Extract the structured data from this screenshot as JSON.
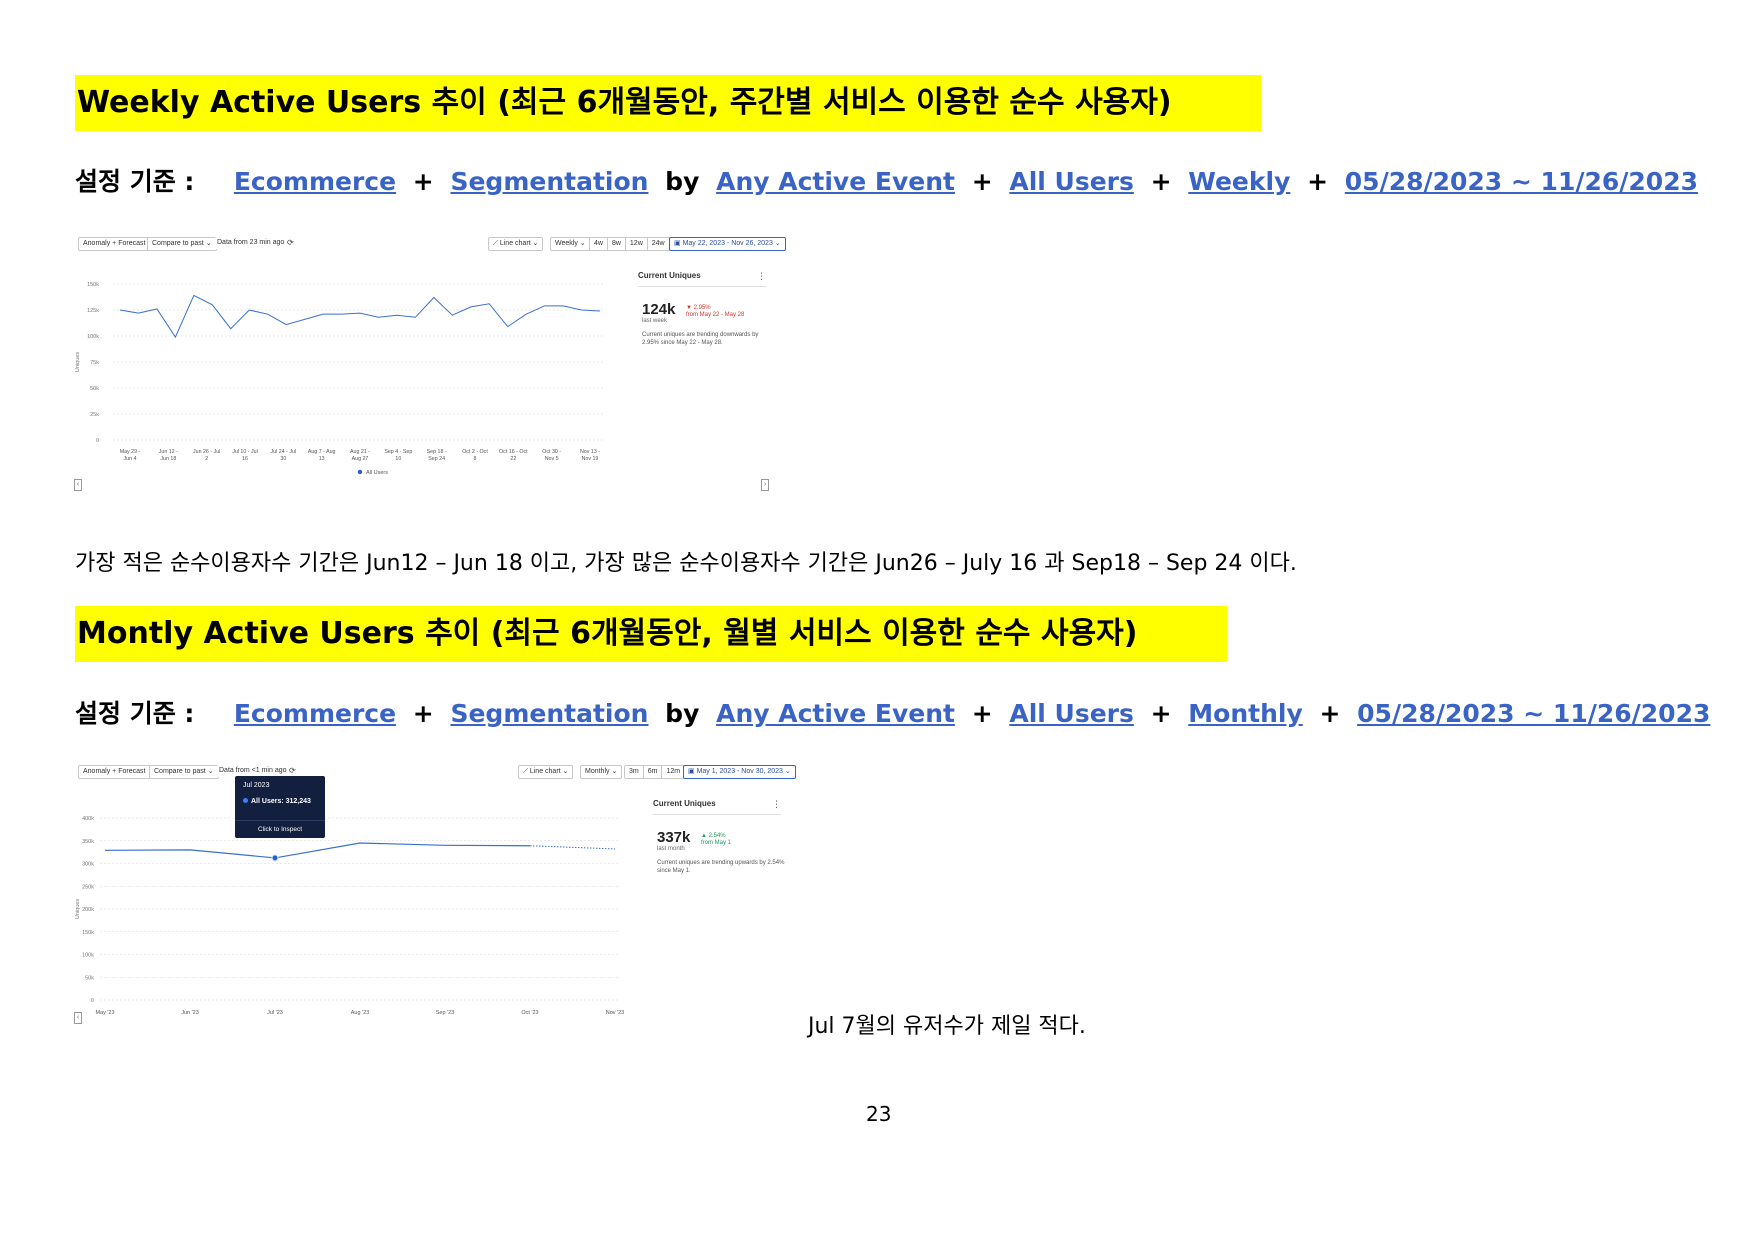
{
  "section1": {
    "heading": "Weekly Active Users 추이 (최근 6개월동안, 주간별 서비스 이용한 순수 사용자)",
    "criteria_label": "설정 기준 :",
    "criteria": {
      "p1": "Ecommerce",
      "op1": "+",
      "p2": "Segmentation",
      "op2": "by",
      "p3": "Any Active Event",
      "op3": "+",
      "p4": "All Users",
      "op4": "+",
      "p5": "Weekly",
      "op5": "+",
      "p6": "05/28/2023 ~ 11/26/2023"
    },
    "toolbar": {
      "anomaly": "Anomaly + Forecast",
      "compare": "Compare to past ⌄",
      "data_from": "Data from 23 min ago",
      "chart_type": "Line chart ⌄",
      "interval": "Weekly ⌄",
      "ranges": [
        "4w",
        "8w",
        "12w",
        "24w"
      ],
      "date_range": "May 22, 2023 - Nov 26, 2023 ⌄"
    },
    "side": {
      "title": "Current Uniques",
      "value": "124k",
      "sub": "last week",
      "delta": "▼ 2.95%",
      "delta_from": "from May 22 - May 28",
      "desc": "Current uniques are trending downwards by 2.95% since May 22 - May 28."
    },
    "note": "가장 적은 순수이용자수 기간은 Jun12 – Jun 18 이고,      가장 많은 순수이용자수 기간은 Jun26 – July 16 과 Sep18 – Sep 24 이다."
  },
  "section2": {
    "heading": "Montly Active Users 추이 (최근 6개월동안, 월별 서비스 이용한 순수 사용자)",
    "criteria_label": "설정 기준 :",
    "criteria": {
      "p1": "Ecommerce",
      "op1": "+",
      "p2": "Segmentation",
      "op2": "by",
      "p3": "Any Active Event",
      "op3": "+",
      "p4": "All Users",
      "op4": "+",
      "p5": "Monthly",
      "op5": "+",
      "p6": "05/28/2023 ~ 11/26/2023"
    },
    "toolbar": {
      "anomaly": "Anomaly + Forecast",
      "compare": "Compare to past ⌄",
      "data_from": "Data from <1 min ago",
      "chart_type": "Line chart ⌄",
      "interval": "Monthly ⌄",
      "ranges": [
        "3m",
        "6m",
        "12m"
      ],
      "date_range": "May 1, 2023 - Nov 30, 2023 ⌄"
    },
    "tooltip": {
      "title": "Jul 2023",
      "value": "All Users: 312,243",
      "action": "Click to Inspect"
    },
    "side": {
      "title": "Current Uniques",
      "value": "337k",
      "sub": "last month",
      "delta": "▲ 2.54%",
      "delta_from": "from May 1",
      "desc": "Current uniques are trending upwards by 2.54% since May 1."
    },
    "note": "Jul 7월의 유저수가 제일 적다."
  },
  "page_number": "23",
  "colors": {
    "highlight": "#ffff00",
    "link": "#3a63c6",
    "line": "#3a6fd0",
    "down": "#d0342c",
    "up": "#1f9d55"
  },
  "chart_data": [
    {
      "type": "line",
      "ylabel": "Uniques",
      "yticks": [
        "0",
        "25k",
        "50k",
        "75k",
        "100k",
        "125k",
        "150k"
      ],
      "ylim": [
        0,
        150000
      ],
      "x_labels": [
        "May 29 -\nJun 4",
        "Jun 12 -\nJun 18",
        "Jun 26 - Jul\n2",
        "Jul 10 - Jul\n16",
        "Jul 24 - Jul\n30",
        "Aug 7 - Aug\n13",
        "Aug 21 -\nAug 27",
        "Sep 4 - Sep\n10",
        "Sep 18 -\nSep 24",
        "Oct 2 - Oct\n8",
        "Oct 16 - Oct\n22",
        "Oct 30 -\nNov 5",
        "Nov 13 -\nNov 19"
      ],
      "series": [
        {
          "name": "All Users",
          "values": [
            125000,
            122000,
            126000,
            99000,
            139000,
            130000,
            107000,
            125000,
            121000,
            111000,
            116000,
            121000,
            121000,
            122000,
            118000,
            120000,
            118000,
            137000,
            120000,
            128000,
            131000,
            109000,
            121000,
            129000,
            129000,
            125000,
            124000
          ]
        }
      ],
      "legend": "bottom"
    },
    {
      "type": "line",
      "ylabel": "Uniques",
      "yticks": [
        "0",
        "50k",
        "100k",
        "150k",
        "200k",
        "250k",
        "300k",
        "350k",
        "400k"
      ],
      "ylim": [
        0,
        400000
      ],
      "categories": [
        "May '23",
        "Jun '23",
        "Jul '23",
        "Aug '23",
        "Sep '23",
        "Oct '23",
        "Nov '23"
      ],
      "series": [
        {
          "name": "All Users",
          "values": [
            329000,
            330000,
            312243,
            345000,
            340000,
            339000,
            332000
          ],
          "projected_from_index": 5
        }
      ]
    }
  ]
}
